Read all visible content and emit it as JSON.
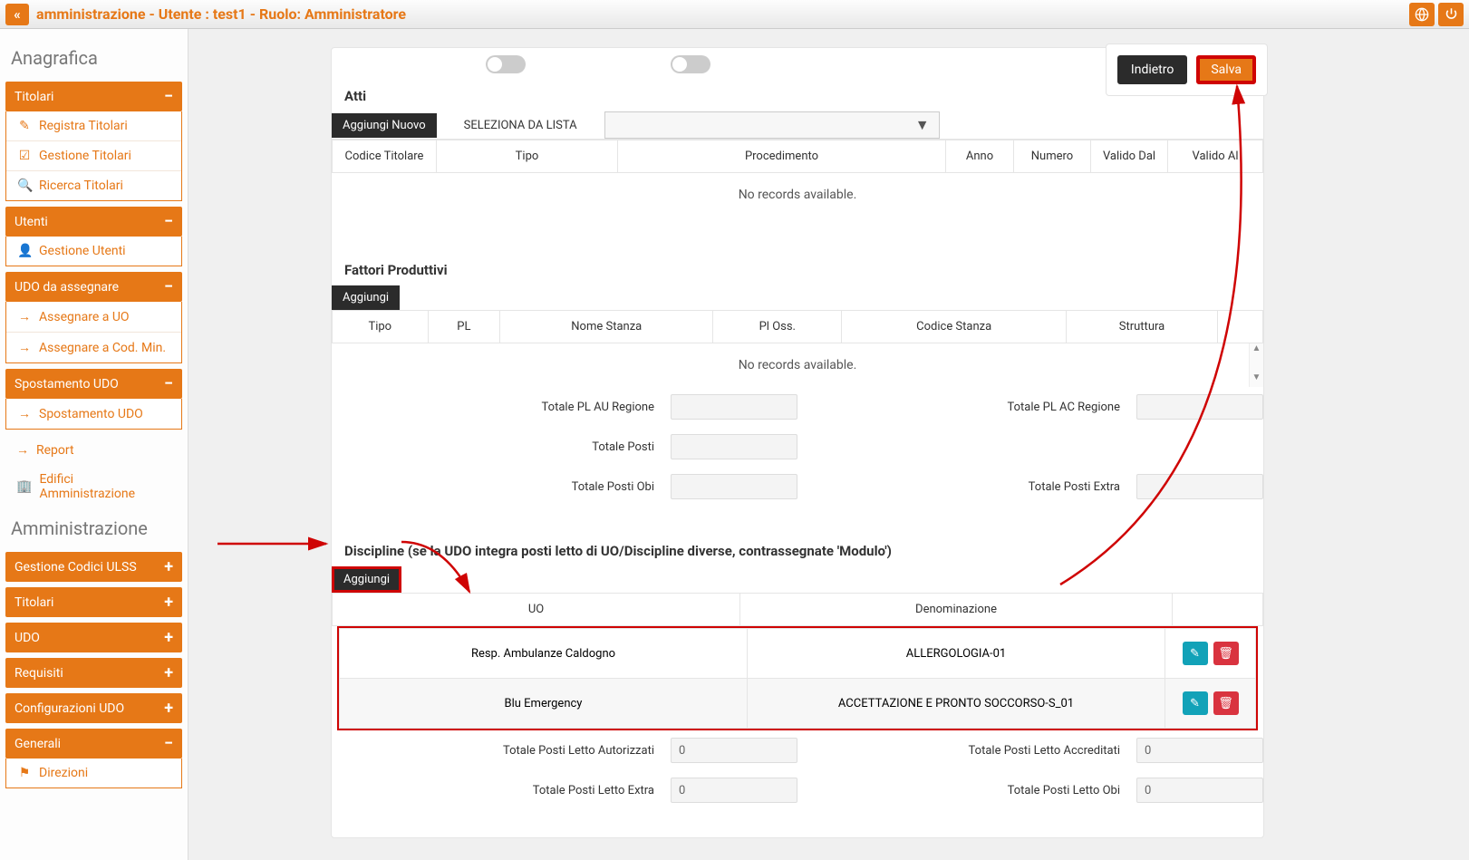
{
  "topbar": {
    "title": "amministrazione - Utente : test1 - Ruolo: Amministratore"
  },
  "sidebar": {
    "heading1": "Anagrafica",
    "heading2": "Amministrazione",
    "titolari": {
      "label": "Titolari",
      "items": [
        "Registra Titolari",
        "Gestione Titolari",
        "Ricerca Titolari"
      ]
    },
    "utenti": {
      "label": "Utenti",
      "items": [
        "Gestione Utenti"
      ]
    },
    "udoass": {
      "label": "UDO da assegnare",
      "items": [
        "Assegnare a UO",
        "Assegnare a Cod. Min."
      ]
    },
    "spost": {
      "label": "Spostamento UDO",
      "items": [
        "Spostamento UDO"
      ]
    },
    "plain": [
      "Report",
      "Edifici Amministrazione"
    ],
    "admin": [
      "Gestione Codici ULSS",
      "Titolari",
      "UDO",
      "Requisiti",
      "Configurazioni UDO"
    ],
    "generali": {
      "label": "Generali",
      "items": [
        "Direzioni"
      ]
    }
  },
  "actions": {
    "back": "Indietro",
    "save": "Salva"
  },
  "atti": {
    "title": "Atti",
    "addNew": "Aggiungi Nuovo",
    "selectList": "SELEZIONA DA LISTA",
    "cols": [
      "Codice Titolare",
      "Tipo",
      "Procedimento",
      "Anno",
      "Numero",
      "Valido Dal",
      "Valido Al"
    ],
    "empty": "No records available."
  },
  "fattori": {
    "title": "Fattori Produttivi",
    "add": "Aggiungi",
    "cols": [
      "Tipo",
      "PL",
      "Nome Stanza",
      "Pl Oss.",
      "Codice Stanza",
      "Struttura"
    ],
    "empty": "No records available.",
    "t1": "Totale PL AU Regione",
    "t2": "Totale PL AC Regione",
    "t3": "Totale Posti",
    "t4": "Totale Posti Obi",
    "t5": "Totale Posti Extra"
  },
  "disc": {
    "title": "Discipline (se la UDO integra posti letto di UO/Discipline diverse, contrassegnate 'Modulo')",
    "add": "Aggiungi",
    "cols": [
      "UO",
      "Denominazione"
    ],
    "rows": [
      {
        "uo": "Resp. Ambulanze Caldogno",
        "den": "ALLERGOLOGIA-01"
      },
      {
        "uo": "Blu Emergency",
        "den": "ACCETTAZIONE E PRONTO SOCCORSO-S_01"
      }
    ],
    "tot": {
      "l1": "Totale Posti Letto Autorizzati",
      "v1": "0",
      "l2": "Totale Posti Letto Accreditati",
      "v2": "0",
      "l3": "Totale Posti Letto Extra",
      "v3": "0",
      "l4": "Totale Posti Letto Obi",
      "v4": "0"
    }
  }
}
